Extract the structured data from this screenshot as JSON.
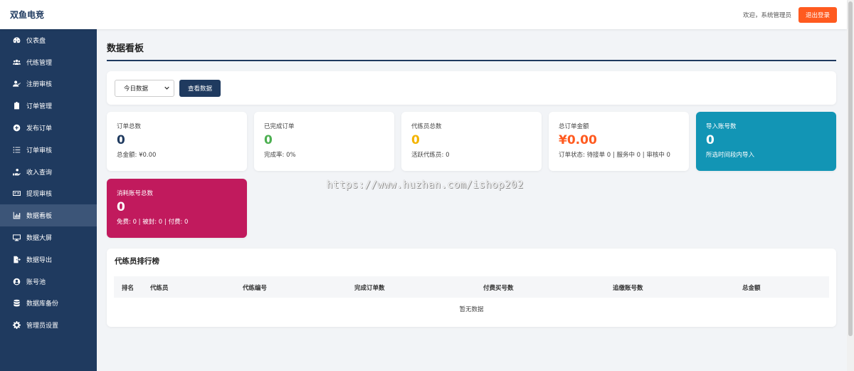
{
  "app": {
    "brand": "双鱼电竞"
  },
  "header": {
    "welcome": "欢迎，系统管理员",
    "logout_label": "退出登录"
  },
  "sidebar": {
    "items": [
      {
        "label": "仪表盘",
        "icon": "dashboard-icon"
      },
      {
        "label": "代练管理",
        "icon": "users-icon"
      },
      {
        "label": "注册审核",
        "icon": "user-check-icon"
      },
      {
        "label": "订单管理",
        "icon": "clipboard-icon"
      },
      {
        "label": "发布订单",
        "icon": "plus-circle-icon"
      },
      {
        "label": "订单审核",
        "icon": "list-icon"
      },
      {
        "label": "收入查询",
        "icon": "hand-coin-icon"
      },
      {
        "label": "提现审核",
        "icon": "money-bill-icon"
      },
      {
        "label": "数据看板",
        "icon": "chart-bar-icon",
        "active": true
      },
      {
        "label": "数据大屏",
        "icon": "monitor-icon"
      },
      {
        "label": "数据导出",
        "icon": "file-export-icon"
      },
      {
        "label": "账号池",
        "icon": "user-circle-icon"
      },
      {
        "label": "数据库备份",
        "icon": "database-icon"
      },
      {
        "label": "管理员设置",
        "icon": "gear-icon"
      }
    ]
  },
  "main": {
    "title": "数据看板",
    "filter": {
      "selected": "今日数据",
      "button_label": "查看数据"
    },
    "stats": {
      "total_orders": {
        "label": "订单总数",
        "value": "0",
        "sub": "总金额: ¥0.00"
      },
      "completed_orders": {
        "label": "已完成订单",
        "value": "0",
        "sub": "完成率: 0%"
      },
      "boosters": {
        "label": "代练员总数",
        "value": "0",
        "sub": "活跃代练员: 0"
      },
      "total_amount": {
        "label": "总订单金额",
        "value": "¥0.00",
        "sub": "订单状态: 待接单 0 | 服务中 0 | 审核中 0"
      },
      "imported_accounts": {
        "label": "导入账号数",
        "value": "0",
        "sub": "所选时间段内导入"
      },
      "consumed_accounts": {
        "label": "消耗账号总数",
        "value": "0",
        "sub": "免费: 0 | 被封: 0 | 付费: 0"
      }
    },
    "ranking": {
      "title": "代练员排行榜",
      "columns": [
        "排名",
        "代练员",
        "代练编号",
        "完成订单数",
        "付费买号数",
        "追缴账号数",
        "总金额"
      ],
      "empty_text": "暂无数据"
    }
  },
  "watermark": "https://www.huzhan.com/ishop202",
  "colors": {
    "sidebar_bg": "#1f3a5f",
    "accent_orange": "#ff5a1f",
    "green": "#4caf50",
    "amber": "#f4b400",
    "teal": "#1295b5",
    "magenta": "#c11a5d"
  }
}
